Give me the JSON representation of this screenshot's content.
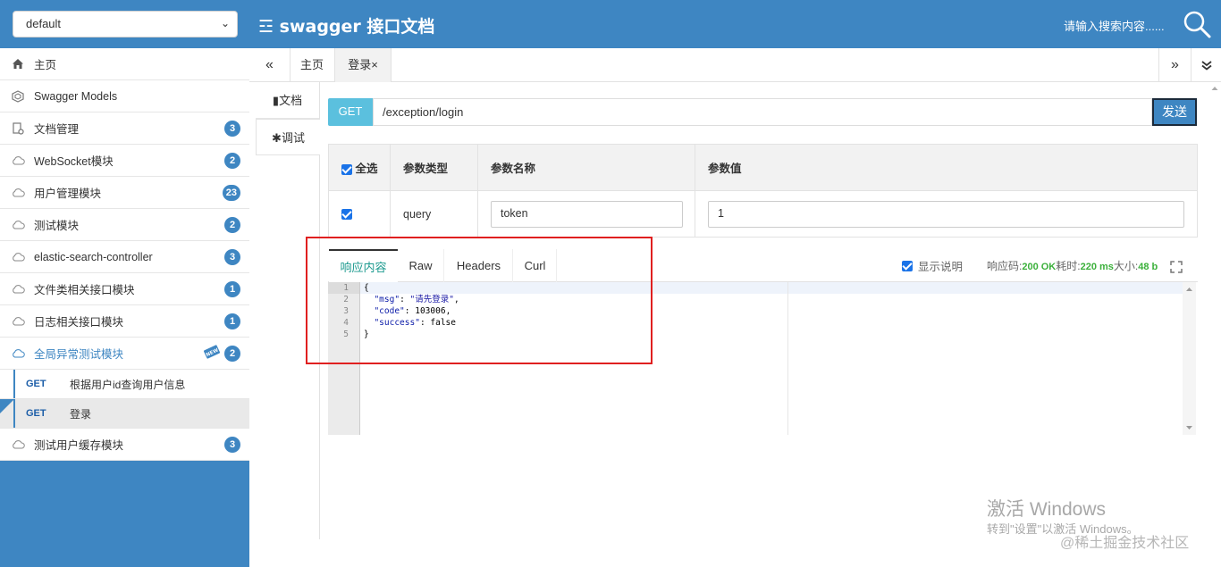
{
  "header": {
    "group_select_value": "default",
    "title": "☲ swagger 接口文档",
    "search_placeholder": "请输入搜索内容......"
  },
  "sidebar": {
    "items": [
      {
        "label": "主页",
        "icon": "home-icon"
      },
      {
        "label": "Swagger Models",
        "icon": "models-icon"
      },
      {
        "label": "文档管理",
        "icon": "doc-manage-icon",
        "badge": "3"
      },
      {
        "label": "WebSocket模块",
        "icon": "cloud-icon",
        "badge": "2"
      },
      {
        "label": "用户管理模块",
        "icon": "cloud-icon",
        "badge": "23"
      },
      {
        "label": "测试模块",
        "icon": "cloud-icon",
        "badge": "2"
      },
      {
        "label": "elastic-search-controller",
        "icon": "cloud-icon",
        "badge": "3"
      },
      {
        "label": "文件类相关接口模块",
        "icon": "cloud-icon",
        "badge": "1"
      },
      {
        "label": "日志相关接口模块",
        "icon": "cloud-icon",
        "badge": "1"
      },
      {
        "label": "全局异常测试模块",
        "icon": "cloud-icon",
        "badge": "2",
        "new_badge": "NEW"
      },
      {
        "label": "测试用户缓存模块",
        "icon": "cloud-icon",
        "badge": "3"
      }
    ],
    "sub_items": [
      {
        "method": "GET",
        "label": "根据用户id查询用户信息"
      },
      {
        "method": "GET",
        "label": "登录"
      }
    ]
  },
  "tabs": {
    "prev": "«",
    "home": "主页",
    "login": "登录",
    "close": "×",
    "next": "»",
    "more": "⌄"
  },
  "left_tabs": {
    "doc": "文档",
    "debug": "调试"
  },
  "request": {
    "method": "GET",
    "url": "/exception/login",
    "send": "发送"
  },
  "params": {
    "headers": {
      "select_all": "全选",
      "type": "参数类型",
      "name": "参数名称",
      "value": "参数值"
    },
    "rows": [
      {
        "type": "query",
        "name": "token",
        "value": "1"
      }
    ]
  },
  "response": {
    "tabs": [
      "响应内容",
      "Raw",
      "Headers",
      "Curl"
    ],
    "show_desc": "显示说明",
    "meta_code_label": "响应码:",
    "meta_code": "200 OK",
    "meta_time_label": "耗时:",
    "meta_time": "220 ms",
    "meta_size_label": "大小:",
    "meta_size": "48 b",
    "line_numbers": [
      "1",
      "2",
      "3",
      "4",
      "5"
    ],
    "code": {
      "open": "{",
      "msg_key": "\"msg\"",
      "msg_val": "\"请先登录\"",
      "code_key": "\"code\"",
      "code_val": "103006",
      "success_key": "\"success\"",
      "success_val": "false",
      "close": "}"
    }
  },
  "watermark": {
    "line1": "激活 Windows",
    "line2": "转到\"设置\"以激活 Windows。",
    "site": "@稀土掘金技术社区"
  },
  "colors": {
    "brand": "#3e86c2",
    "get_badge": "#5bc0de",
    "response_active": "#1d9a8f",
    "highlight_box": "#e02020"
  }
}
